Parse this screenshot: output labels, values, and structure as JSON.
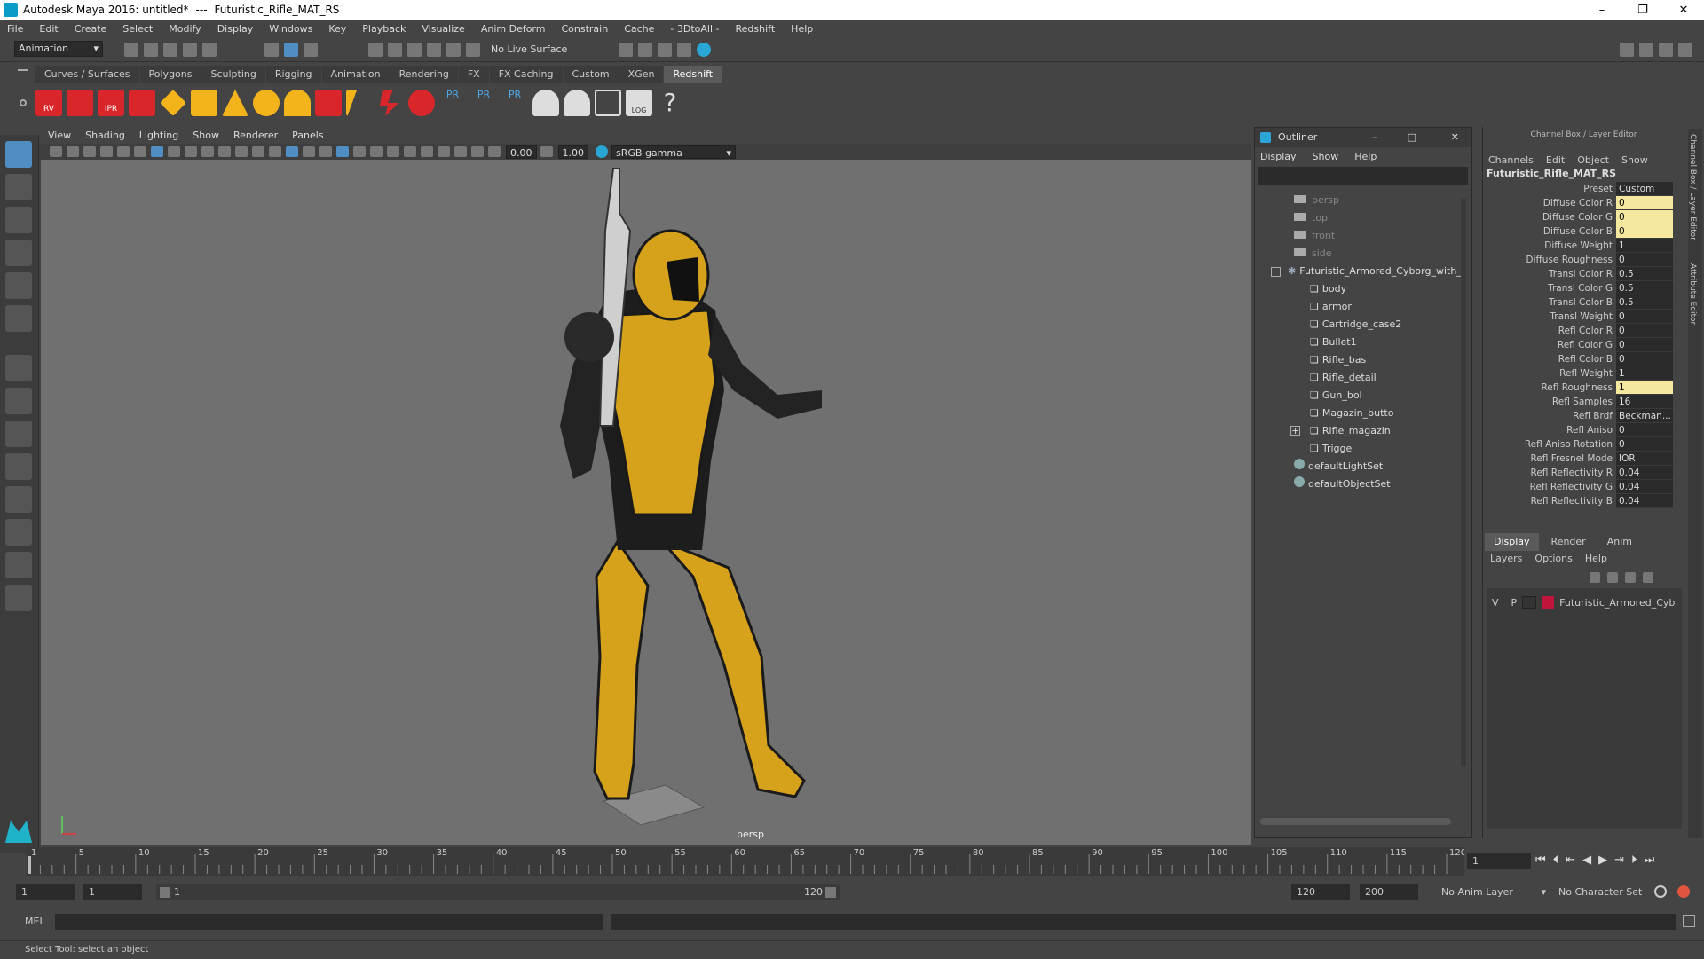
{
  "window": {
    "app_title": "Autodesk Maya 2016: untitled*",
    "separator": "---",
    "scene_object": "Futuristic_Rifle_MAT_RS"
  },
  "menubar": [
    "File",
    "Edit",
    "Create",
    "Select",
    "Modify",
    "Display",
    "Windows",
    "Key",
    "Playback",
    "Visualize",
    "Anim Deform",
    "Constrain",
    "Cache",
    "- 3DtoAll -",
    "Redshift",
    "Help"
  ],
  "statusline": {
    "menuset": "Animation",
    "live_surface": "No Live Surface"
  },
  "shelf_tabs": [
    "Curves / Surfaces",
    "Polygons",
    "Sculpting",
    "Rigging",
    "Animation",
    "Rendering",
    "FX",
    "FX Caching",
    "Custom",
    "XGen",
    "Redshift"
  ],
  "shelf_active": "Redshift",
  "shelf_labels": {
    "rv": "RV",
    "ipr": "IPR",
    "pr": "PR",
    "log": "LOG",
    "help": "?"
  },
  "viewport": {
    "menus": [
      "View",
      "Shading",
      "Lighting",
      "Show",
      "Renderer",
      "Panels"
    ],
    "exposure": "0.00",
    "gamma": "1.00",
    "color_space": "sRGB gamma",
    "camera": "persp"
  },
  "outliner": {
    "title": "Outliner",
    "menus": [
      "Display",
      "Show",
      "Help"
    ],
    "items": [
      {
        "label": "persp",
        "type": "camera",
        "indent": 0
      },
      {
        "label": "top",
        "type": "camera",
        "indent": 0
      },
      {
        "label": "front",
        "type": "camera",
        "indent": 0
      },
      {
        "label": "side",
        "type": "camera",
        "indent": 0
      },
      {
        "label": "Futuristic_Armored_Cyborg_with_",
        "type": "group",
        "indent": 0
      },
      {
        "label": "body",
        "type": "mesh",
        "indent": 1
      },
      {
        "label": "armor",
        "type": "mesh",
        "indent": 1
      },
      {
        "label": "Cartridge_case2",
        "type": "mesh",
        "indent": 1
      },
      {
        "label": "Bullet1",
        "type": "mesh",
        "indent": 1
      },
      {
        "label": "Rifle_bas",
        "type": "mesh",
        "indent": 1
      },
      {
        "label": "Rifle_detail",
        "type": "mesh",
        "indent": 1
      },
      {
        "label": "Gun_bol",
        "type": "mesh",
        "indent": 1
      },
      {
        "label": "Magazin_butto",
        "type": "mesh",
        "indent": 1
      },
      {
        "label": "Rifle_magazin",
        "type": "mesh",
        "indent": 1
      },
      {
        "label": "Trigge",
        "type": "mesh",
        "indent": 1
      },
      {
        "label": "defaultLightSet",
        "type": "set",
        "indent": 0
      },
      {
        "label": "defaultObjectSet",
        "type": "set",
        "indent": 0
      }
    ]
  },
  "channelbox": {
    "title": "Channel Box / Layer Editor",
    "menus": [
      "Channels",
      "Edit",
      "Object",
      "Show"
    ],
    "node": "Futuristic_Rifle_MAT_RS",
    "attrs": [
      {
        "label": "Preset",
        "value": "Custom",
        "hl": false
      },
      {
        "label": "Diffuse Color R",
        "value": "0",
        "hl": true
      },
      {
        "label": "Diffuse Color G",
        "value": "0",
        "hl": true
      },
      {
        "label": "Diffuse Color B",
        "value": "0",
        "hl": true
      },
      {
        "label": "Diffuse Weight",
        "value": "1",
        "hl": false
      },
      {
        "label": "Diffuse Roughness",
        "value": "0",
        "hl": false
      },
      {
        "label": "Transl Color R",
        "value": "0.5",
        "hl": false
      },
      {
        "label": "Transl Color G",
        "value": "0.5",
        "hl": false
      },
      {
        "label": "Transl Color B",
        "value": "0.5",
        "hl": false
      },
      {
        "label": "Transl Weight",
        "value": "0",
        "hl": false
      },
      {
        "label": "Refl Color R",
        "value": "0",
        "hl": false
      },
      {
        "label": "Refl Color G",
        "value": "0",
        "hl": false
      },
      {
        "label": "Refl Color B",
        "value": "0",
        "hl": false
      },
      {
        "label": "Refl Weight",
        "value": "1",
        "hl": false
      },
      {
        "label": "Refl Roughness",
        "value": "1",
        "hl": true
      },
      {
        "label": "Refl Samples",
        "value": "16",
        "hl": false
      },
      {
        "label": "Refl Brdf",
        "value": "Beckman...",
        "hl": false
      },
      {
        "label": "Refl Aniso",
        "value": "0",
        "hl": false
      },
      {
        "label": "Refl Aniso Rotation",
        "value": "0",
        "hl": false
      },
      {
        "label": "Refl Fresnel Mode",
        "value": "IOR",
        "hl": false
      },
      {
        "label": "Refl Reflectivity R",
        "value": "0.04",
        "hl": false
      },
      {
        "label": "Refl Reflectivity G",
        "value": "0.04",
        "hl": false
      },
      {
        "label": "Refl Reflectivity B",
        "value": "0.04",
        "hl": false
      }
    ],
    "layer_tabs": [
      "Display",
      "Render",
      "Anim"
    ],
    "layer_menus": [
      "Layers",
      "Options",
      "Help"
    ],
    "layer": {
      "v": "V",
      "p": "P",
      "name": "Futuristic_Armored_Cybo"
    }
  },
  "side_tabs": {
    "a": "Channel Box / Layer Editor",
    "b": "Attribute Editor"
  },
  "timeline": {
    "ticks": [
      "1",
      "5",
      "10",
      "15",
      "20",
      "25",
      "30",
      "35",
      "40",
      "45",
      "50",
      "55",
      "60",
      "65",
      "70",
      "75",
      "80",
      "85",
      "90",
      "95",
      "100",
      "105",
      "110",
      "115",
      "120"
    ],
    "current_frame": "1"
  },
  "range": {
    "start": "1",
    "playback_start": "1",
    "slider_start": "1",
    "slider_end": "120",
    "playback_end": "120",
    "end": "200",
    "anim_layer": "No Anim Layer",
    "char_set": "No Character Set"
  },
  "cmdline": {
    "lang": "MEL"
  },
  "helpline": "Select Tool: select an object"
}
